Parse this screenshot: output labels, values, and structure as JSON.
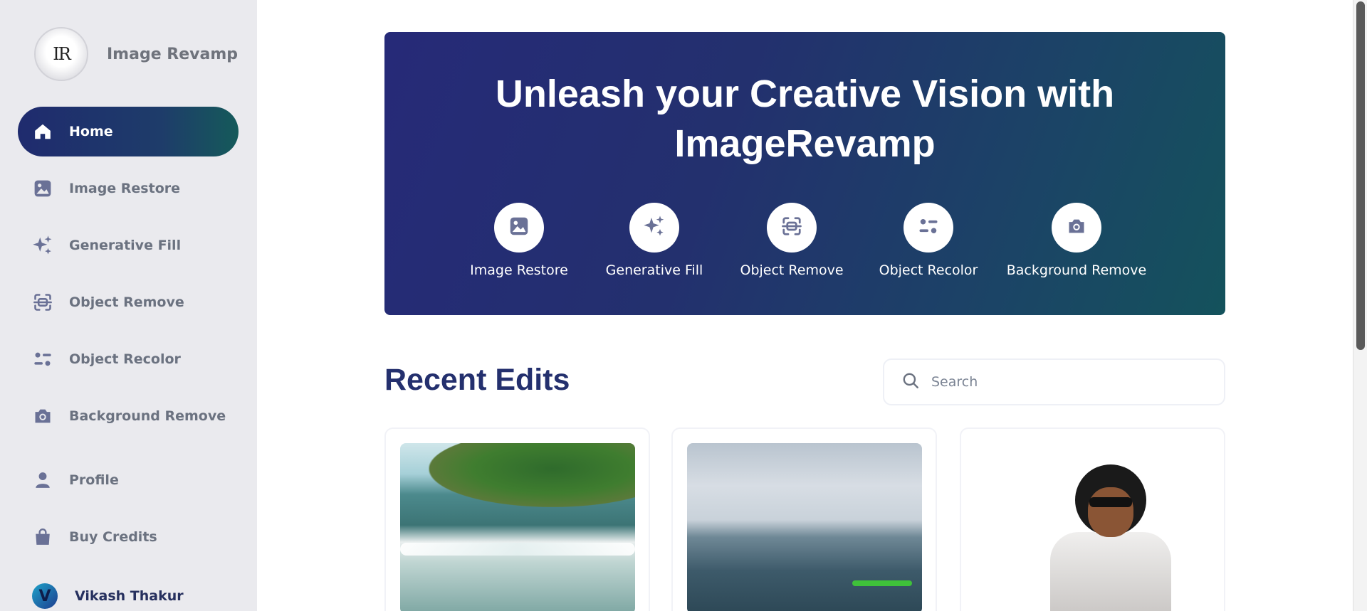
{
  "brand": {
    "name": "Image Revamp",
    "logo_text": "IR"
  },
  "sidebar": {
    "items": [
      {
        "label": "Home",
        "icon": "home-icon",
        "active": true
      },
      {
        "label": "Image Restore",
        "icon": "image-icon"
      },
      {
        "label": "Generative Fill",
        "icon": "sparkles-icon"
      },
      {
        "label": "Object Remove",
        "icon": "scan-icon"
      },
      {
        "label": "Object Recolor",
        "icon": "filter-icon"
      },
      {
        "label": "Background Remove",
        "icon": "camera-icon"
      }
    ],
    "lower_items": [
      {
        "label": "Profile",
        "icon": "user-icon"
      },
      {
        "label": "Buy Credits",
        "icon": "bag-icon"
      }
    ],
    "user": {
      "name": "Vikash Thakur",
      "initial": "V"
    }
  },
  "hero": {
    "title": "Unleash your Creative Vision with ImageRevamp",
    "tools": [
      {
        "label": "Image Restore",
        "icon": "image-icon"
      },
      {
        "label": "Generative Fill",
        "icon": "sparkles-icon"
      },
      {
        "label": "Object Remove",
        "icon": "scan-icon"
      },
      {
        "label": "Object Recolor",
        "icon": "filter-icon"
      },
      {
        "label": "Background Remove",
        "icon": "camera-icon"
      }
    ]
  },
  "recent": {
    "title": "Recent Edits",
    "search_placeholder": "Search"
  },
  "colors": {
    "accent": "#24306e",
    "hero_start": "#262a78",
    "hero_end": "#14525c",
    "sidebar_bg": "#eaeaee"
  }
}
